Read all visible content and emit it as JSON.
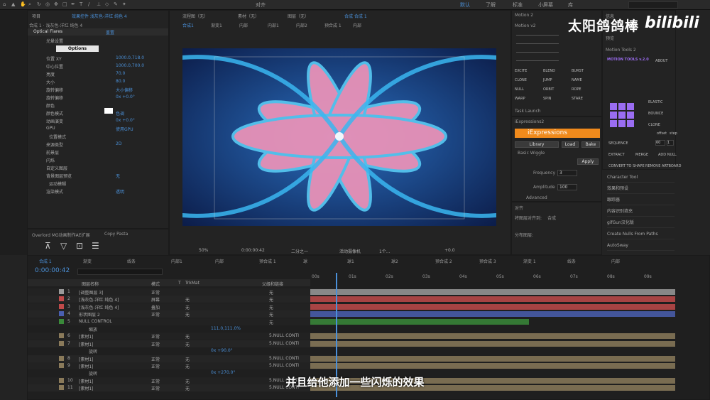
{
  "toolbar": {
    "right_items": [
      "对齐",
      "默认",
      "了解",
      "标准",
      "小屏幕",
      "库"
    ],
    "search_placeholder": "搜索帮助"
  },
  "effects_panel": {
    "tab_project": "项目",
    "tab_effects": "效果控件 浅灰色-洋红 纯色 4",
    "breadcrumb": "合成 1 · 浅灰色-洋红 纯色 4",
    "effect_name": "Optical Flares",
    "reset": "重置",
    "rows": [
      {
        "label": "光晕设置",
        "value": ""
      },
      {
        "label": "",
        "value": "Options"
      },
      {
        "label": "位置 XY",
        "value": "1000.0,718.0"
      },
      {
        "label": "中心位置",
        "value": "1000.0,700.0"
      },
      {
        "label": "亮度",
        "value": "70.0"
      },
      {
        "label": "大小",
        "value": "80.0"
      },
      {
        "label": "旋转偏移",
        "value": "大小偏移"
      },
      {
        "label": "旋转偏移",
        "value": "0x +0.0°"
      },
      {
        "label": "颜色",
        "value": ""
      },
      {
        "label": "颜色模式",
        "value": "色调"
      },
      {
        "label": "动画演变",
        "value": "0x +0.0°"
      },
      {
        "label": "GPU",
        "value": "使用GPU"
      },
      {
        "label": "位置模式",
        "value": ""
      },
      {
        "label": "来源类型",
        "value": "2D"
      },
      {
        "label": "前景层",
        "value": ""
      },
      {
        "label": "闪烁",
        "value": ""
      },
      {
        "label": "自定义图层",
        "value": ""
      },
      {
        "label": "背景图层预览",
        "value": "无"
      },
      {
        "label": "运动模糊",
        "value": ""
      },
      {
        "label": "渲染模式",
        "value": "透明"
      }
    ],
    "bottom_tabs": [
      "Overlord MG动画制作AE扩展",
      "Copy Pasta"
    ]
  },
  "viewer": {
    "tabs": [
      "流程图（无）",
      "素材（无）",
      "图层（无）",
      "合成 合成 1"
    ],
    "breadcrumbs": [
      "合成1",
      "渐变1",
      "内部",
      "内部1",
      "内部2",
      "预合成 1",
      "内部"
    ],
    "zoom": "50%",
    "timecode": "0:00:00:42",
    "resolution": "二分之一",
    "camera": "活动摄像机",
    "views": "1个...",
    "exposure": "+0.0"
  },
  "motion2": {
    "title": "Motion 2",
    "version": "Motion v2",
    "tools": [
      "EXCITE",
      "BLEND",
      "BURST",
      "CLONE",
      "JUMP",
      "NAME",
      "NULL",
      "ORBIT",
      "ROPE",
      "WARP",
      "SPIN",
      "STARE"
    ],
    "task": "Task Launch"
  },
  "iexpressions": {
    "title": "iExpressions2",
    "logo": "iExpressions",
    "buttons": [
      "Library",
      "Load",
      "Bake"
    ],
    "wiggle": "Basic Wiggle",
    "apply": "Apply",
    "frequency_label": "Frequency",
    "frequency": "3",
    "amplitude_label": "Amplitude",
    "amplitude": "100",
    "advanced": "Advanced"
  },
  "align": {
    "title": "对齐",
    "align_to": "将图层对齐到:",
    "target": "合成",
    "distribute": "分布图层:"
  },
  "info": {
    "title": "信息",
    "preview": "预览",
    "motion_tools": "Motion Tools 2",
    "mt_logo": "MOTION TOOLS v.2.0",
    "about": "ABOUT",
    "labels": [
      "ELASTIC",
      "BOUNCE",
      "CLONE",
      "offset",
      "step",
      "SEQUENCE",
      "EXTRACT",
      "MERGE",
      "ADD NULL",
      "CONVERT TO SHAPE",
      "REMOVE ARTBOARD"
    ],
    "offset": "60",
    "step": "1"
  },
  "right_list": [
    "Character Tool",
    "效果和预设",
    "跟踪器",
    "内容识别填充",
    "gifGun汉化版",
    "Create Nulls From Paths",
    "AutoSway"
  ],
  "timeline": {
    "tabs": [
      "合成 1",
      "渐变",
      "线条",
      "内部1",
      "内部",
      "预合成 1",
      "球",
      "球1",
      "球2",
      "预合成 2",
      "预合成 3",
      "渐变 1",
      "线条",
      "内部"
    ],
    "timecode": "0:00:00:42",
    "headers": [
      "图层名称",
      "模式",
      "T",
      "TrkMat",
      "父级和链接"
    ],
    "ruler": [
      "00s",
      "01s",
      "02s",
      "03s",
      "04s",
      "05s",
      "06s",
      "07s",
      "08s",
      "09s"
    ],
    "layers": [
      {
        "num": "1",
        "name": "[调整图层 3]",
        "mode": "正常",
        "trk": "",
        "parent": "无",
        "color": "#9a9a9a"
      },
      {
        "num": "2",
        "name": "[浅灰色-洋红 纯色 4]",
        "mode": "屏幕",
        "trk": "无",
        "parent": "无",
        "color": "#c04a4a"
      },
      {
        "num": "3",
        "name": "[浅灰色-洋红 纯色 4]",
        "mode": "叠加",
        "trk": "无",
        "parent": "无",
        "color": "#c04a4a"
      },
      {
        "num": "4",
        "name": "形状图层 2",
        "mode": "正常",
        "trk": "无",
        "parent": "无",
        "color": "#4a5fb0"
      },
      {
        "num": "5",
        "name": "NULL CONTROL",
        "mode": "",
        "trk": "",
        "parent": "无",
        "color": "#3a8a3a"
      },
      {
        "num": "",
        "name": "缩放",
        "mode": "",
        "trk": "",
        "parent": "111.0,111.0%",
        "color": ""
      },
      {
        "num": "6",
        "name": "[素材1]",
        "mode": "正常",
        "trk": "无",
        "parent": "5.NULL CONTI",
        "color": "#8a7a5a"
      },
      {
        "num": "7",
        "name": "[素材1]",
        "mode": "正常",
        "trk": "无",
        "parent": "5.NULL CONTI",
        "color": "#8a7a5a"
      },
      {
        "num": "",
        "name": "旋转",
        "mode": "",
        "trk": "",
        "parent": "0x +90.0°",
        "color": ""
      },
      {
        "num": "8",
        "name": "[素材1]",
        "mode": "正常",
        "trk": "无",
        "parent": "5.NULL CONTI",
        "color": "#8a7a5a"
      },
      {
        "num": "9",
        "name": "[素材1]",
        "mode": "正常",
        "trk": "无",
        "parent": "5.NULL CONTI",
        "color": "#8a7a5a"
      },
      {
        "num": "",
        "name": "旋转",
        "mode": "",
        "trk": "",
        "parent": "0x +270.0°",
        "color": ""
      },
      {
        "num": "10",
        "name": "[素材1]",
        "mode": "正常",
        "trk": "无",
        "parent": "5.NULL CONTI",
        "color": "#8a7a5a"
      },
      {
        "num": "11",
        "name": "[素材1]",
        "mode": "正常",
        "trk": "无",
        "parent": "5.NULL CONTI",
        "color": "#8a7a5a"
      }
    ]
  },
  "overlay": {
    "watermark": "太阳鸽鸽棒",
    "subtitle": "并且给他添加一些闪烁的效果"
  },
  "colors": {
    "accent": "#4a90d9",
    "panel": "#232323",
    "toolbar": "#2a2a2a"
  }
}
